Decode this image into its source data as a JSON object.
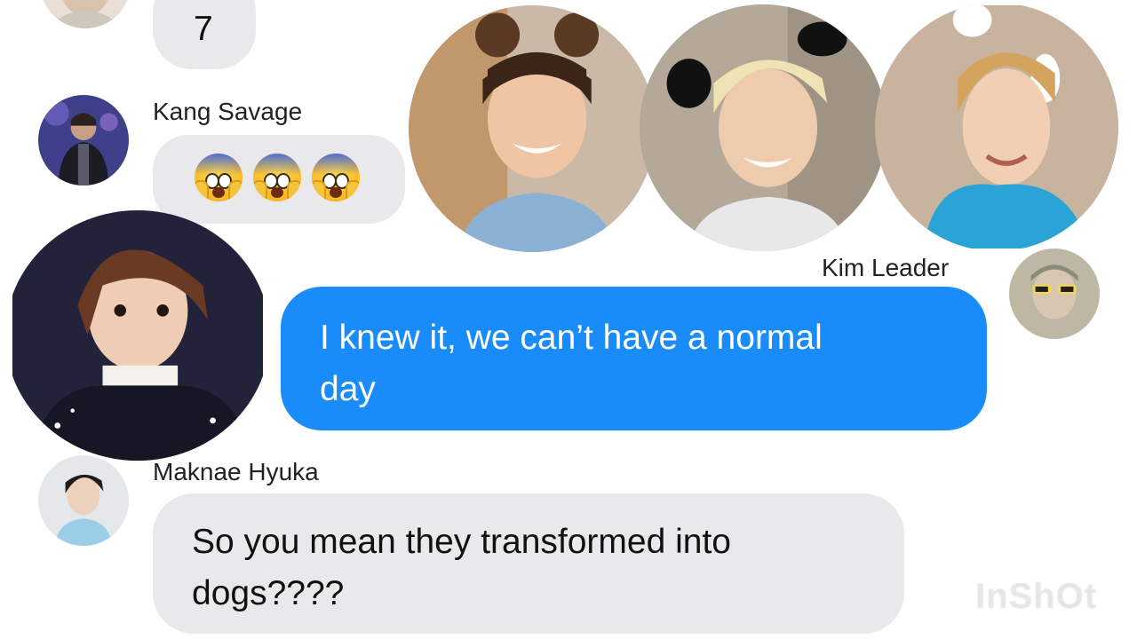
{
  "messages": {
    "m1": {
      "text": "7"
    },
    "m2": {
      "sender": "Kang Savage",
      "emoji_count": 3,
      "emoji_icon": "screaming-face-emoji"
    },
    "m3": {
      "sender": "Kim Leader",
      "text_line1": "I knew it, we can’t have a normal",
      "text_line2": "day"
    },
    "m4": {
      "sender": "Maknae Hyuka",
      "text_line1": "So you mean they transformed into",
      "text_line2": "dogs????"
    }
  },
  "overlays": {
    "photos": [
      "boy-with-bear-ears-photo",
      "boy-with-panda-ears-photo",
      "boy-with-white-ears-photo",
      "surprised-boy-photo"
    ]
  },
  "watermark": "InShOt",
  "colors": {
    "incoming_bubble": "#e9e9eb",
    "outgoing_bubble": "#1a8cf9",
    "background": "#ffffff"
  }
}
